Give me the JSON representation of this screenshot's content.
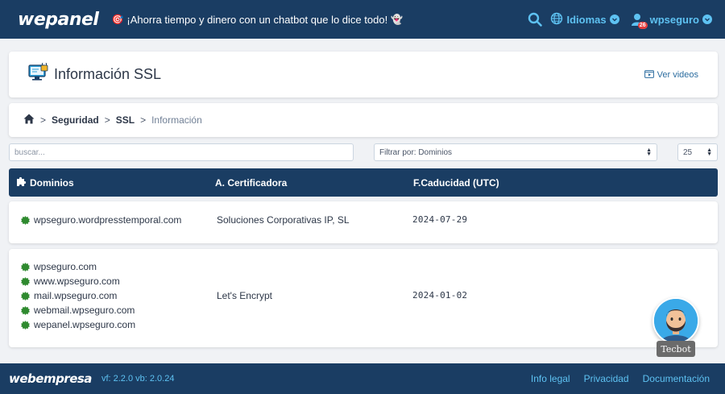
{
  "header": {
    "logo": "wepanel",
    "promo": "¡Ahorra tiempo y dinero con un chatbot que lo dice todo!",
    "languages_label": "Idiomas",
    "user_label": "wpseguro",
    "notification_count": "26"
  },
  "page": {
    "title": "Información SSL",
    "videos_link": "Ver videos"
  },
  "breadcrumb": {
    "items": [
      "Seguridad",
      "SSL",
      "Información"
    ]
  },
  "filters": {
    "search_placeholder": "buscar...",
    "filter_value": "Filtrar por: Dominios",
    "page_size": "25"
  },
  "table": {
    "headers": [
      "Dominios",
      "A. Certificadora",
      "F.Caducidad (UTC)"
    ],
    "rows": [
      {
        "domains": [
          "wpseguro.wordpresstemporal.com"
        ],
        "authority": "Soluciones Corporativas IP, SL",
        "expiry": "2024-07-29"
      },
      {
        "domains": [
          "wpseguro.com",
          "www.wpseguro.com",
          "mail.wpseguro.com",
          "webmail.wpseguro.com",
          "wepanel.wpseguro.com"
        ],
        "authority": "Let's Encrypt",
        "expiry": "2024-01-02"
      }
    ]
  },
  "chatbot": {
    "label": "Tecbot"
  },
  "footer": {
    "logo": "webempresa",
    "version": "vf: 2.2.0 vb: 2.0.24",
    "links": [
      "Info legal",
      "Privacidad",
      "Documentación"
    ]
  },
  "colors": {
    "navy": "#1a3d63",
    "accent": "#5ec2f2",
    "seal_green": "#2f8a2f"
  }
}
